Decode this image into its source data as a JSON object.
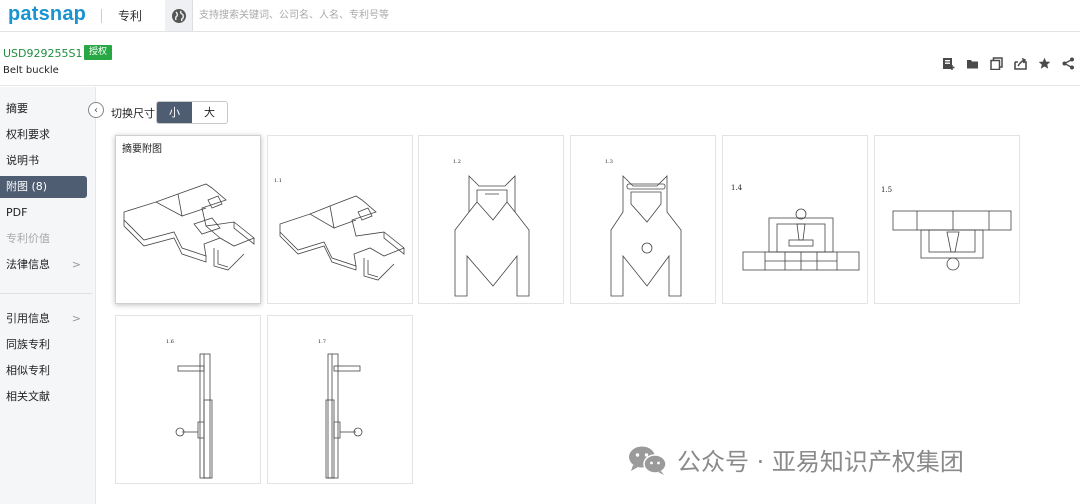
{
  "top": {
    "logo": "patsnap",
    "nav_label": "专利",
    "search_placeholder": "支持搜索关键词、公司名、人名、专利号等"
  },
  "header": {
    "publication_number": "USD929255S1",
    "status_badge": "授权",
    "title": "Belt buckle",
    "tools": [
      "save-icon",
      "folder-icon",
      "copy-icon",
      "export-icon",
      "star-icon",
      "share-icon"
    ]
  },
  "sidebar": {
    "items": [
      {
        "label": "摘要"
      },
      {
        "label": "权利要求"
      },
      {
        "label": "说明书"
      },
      {
        "label": "附图 (8)"
      },
      {
        "label": "PDF"
      },
      {
        "label": "专利价值"
      },
      {
        "label": "法律信息",
        "chevron": ">"
      },
      {
        "label": "引用信息",
        "chevron": ">"
      },
      {
        "label": "同族专利"
      },
      {
        "label": "相似专利"
      },
      {
        "label": "相关文献"
      }
    ]
  },
  "size_toggle": {
    "label": "切换尺寸",
    "small": "小",
    "large": "大"
  },
  "gallery": {
    "abstract_caption": "摘要附图",
    "fig_labels": [
      "1.1",
      "1.2",
      "1.3",
      "1.4",
      "1.5",
      "1.6",
      "1.7"
    ]
  },
  "watermark": {
    "text": "公众号 · 亚易知识产权集团"
  },
  "colors": {
    "brand": "#1a93d1",
    "active_nav": "#4f5d73",
    "granted_badge": "#27a844",
    "pub_number": "#1e8e3e"
  }
}
